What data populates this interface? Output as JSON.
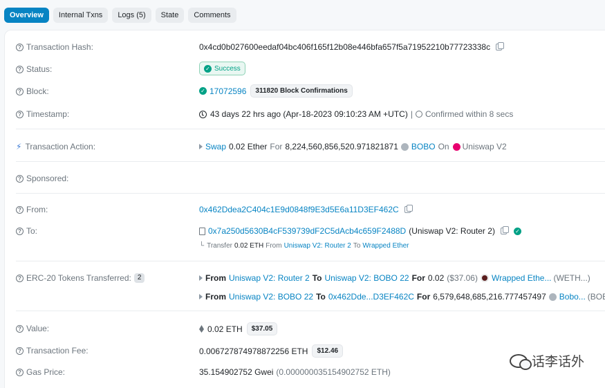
{
  "tabs": [
    {
      "label": "Overview",
      "active": true
    },
    {
      "label": "Internal Txns"
    },
    {
      "label": "Logs (5)"
    },
    {
      "label": "State"
    },
    {
      "label": "Comments"
    }
  ],
  "labels": {
    "tx_hash": "Transaction Hash:",
    "status": "Status:",
    "block": "Block:",
    "timestamp": "Timestamp:",
    "tx_action": "Transaction Action:",
    "sponsored": "Sponsored:",
    "from": "From:",
    "to": "To:",
    "erc20": "ERC-20 Tokens Transferred:",
    "value": "Value:",
    "tx_fee": "Transaction Fee:",
    "gas_price": "Gas Price:"
  },
  "tx_hash": "0x4cd0b027600eedaf04bc406f165f12b08e446bfa657f5a71952210b77723338c",
  "status": "Success",
  "block": {
    "number": "17072596",
    "confirmations": "311820 Block Confirmations"
  },
  "timestamp": {
    "main": "43 days 22 hrs ago (Apr-18-2023 09:10:23 AM +UTC)",
    "sep": "|",
    "confirmed": "Confirmed within 8 secs"
  },
  "action": {
    "swap": "Swap",
    "amount": "0.02 Ether",
    "for": "For",
    "tokens": "8,224,560,856,520.971821871",
    "token": "BOBO",
    "on": "On",
    "dex": "Uniswap V2"
  },
  "from_address": "0x462Ddea2C404c1E9d0848f9E3d5E6a11D3EF462C",
  "to": {
    "address": "0x7a250d5630B4cF539739dF2C5dAcb4c659F2488D",
    "name": "(Uniswap V2: Router 2)",
    "internal": {
      "prefix": "Transfer",
      "amount": "0.02 ETH",
      "from_word": "From",
      "from": "Uniswap V2: Router 2",
      "to_word": "To",
      "to": "Wrapped Ether"
    }
  },
  "erc20": {
    "count": "2",
    "transfers": [
      {
        "from_word": "From",
        "from": "Uniswap V2: Router 2",
        "to_word": "To",
        "to": "Uniswap V2: BOBO 22",
        "for_word": "For",
        "amount": "0.02",
        "usd": "($37.06)",
        "token": "Wrapped Ethe...",
        "symbol": "(WETH...)"
      },
      {
        "from_word": "From",
        "from": "Uniswap V2: BOBO 22",
        "to_word": "To",
        "to": "0x462Dde...D3EF462C",
        "for_word": "For",
        "amount": "6,579,648,685,216.777457497",
        "usd": "",
        "token": "Bobo...",
        "symbol": "(BOBO...)"
      }
    ]
  },
  "value": {
    "eth": "0.02 ETH",
    "usd": "$37.05"
  },
  "fee": {
    "eth": "0.006727874978872256 ETH",
    "usd": "$12.46"
  },
  "gas": {
    "gwei": "35.154902752 Gwei",
    "eth": "(0.000000035154902752 ETH)"
  },
  "watermark": "话李话外"
}
